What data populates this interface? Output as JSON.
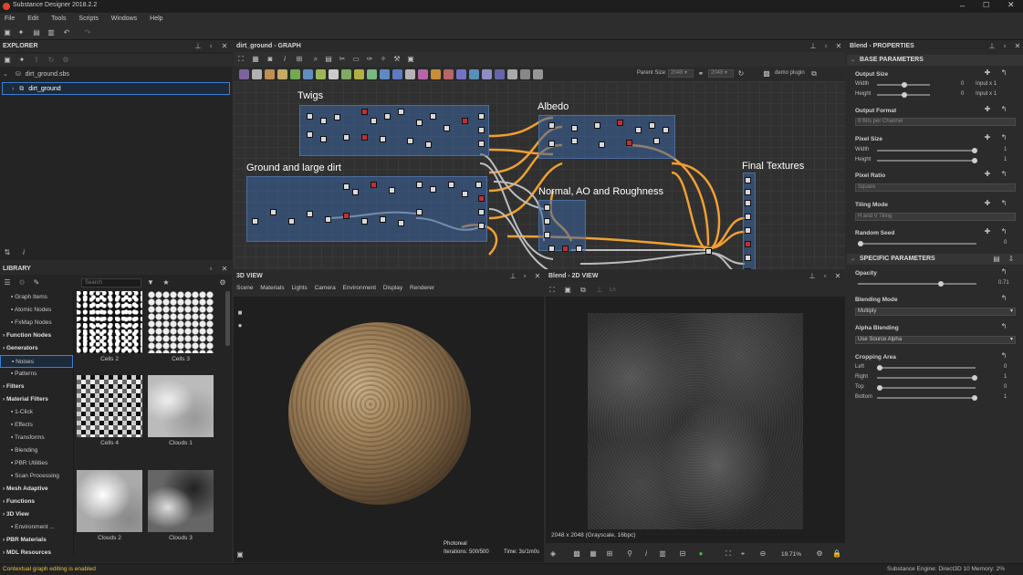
{
  "app": {
    "title": "Substance Designer 2018.2.2"
  },
  "menu": [
    "File",
    "Edit",
    "Tools",
    "Scripts",
    "Windows",
    "Help"
  ],
  "explorer": {
    "title": "EXPLORER",
    "file": "dirt_ground.sbs",
    "graph": "dirt_ground"
  },
  "library": {
    "title": "LIBRARY",
    "search_placeholder": "Search",
    "categories": [
      {
        "label": "Graph Items",
        "bold": false
      },
      {
        "label": "Atomic Nodes",
        "bold": false
      },
      {
        "label": "FxMap Nodes",
        "bold": false
      },
      {
        "label": "Function Nodes",
        "bold": true
      },
      {
        "label": "Generators",
        "bold": true
      },
      {
        "label": "Noises",
        "bold": false,
        "selected": true
      },
      {
        "label": "Patterns",
        "bold": false
      },
      {
        "label": "Filters",
        "bold": true
      },
      {
        "label": "Material Filters",
        "bold": true
      },
      {
        "label": "1-Click",
        "bold": false
      },
      {
        "label": "Effects",
        "bold": false
      },
      {
        "label": "Transforms",
        "bold": false
      },
      {
        "label": "Blending",
        "bold": false
      },
      {
        "label": "PBR Utilities",
        "bold": false
      },
      {
        "label": "Scan Processing",
        "bold": false
      },
      {
        "label": "Mesh Adaptive",
        "bold": true
      },
      {
        "label": "Functions",
        "bold": true
      },
      {
        "label": "3D View",
        "bold": true
      },
      {
        "label": "Environment ...",
        "bold": false
      },
      {
        "label": "PBR Materials",
        "bold": true
      },
      {
        "label": "MDL Resources",
        "bold": true
      }
    ],
    "thumbs": [
      "Cells 2",
      "Cells 3",
      "Cells 4",
      "Clouds 1",
      "Clouds 2",
      "Clouds 3"
    ]
  },
  "graph": {
    "title": "dirt_ground - GRAPH",
    "parent_size_label": "Parent Size:",
    "parent_size": "2048",
    "size2": "2048",
    "plugin": "demo plugin",
    "frames": [
      "Twigs",
      "Albedo",
      "Ground and large dirt",
      "Normal, AO and Roughness",
      "Final Textures"
    ]
  },
  "view3d": {
    "title": "3D VIEW",
    "menu": [
      "Scene",
      "Materials",
      "Lights",
      "Camera",
      "Environment",
      "Display",
      "Renderer"
    ],
    "renderer": "Photoreal",
    "iterations": "Iterations: 500/500",
    "time": "Time: 3s/1m0s"
  },
  "view2d": {
    "title": "Blend - 2D VIEW",
    "dropdown": "Lh",
    "info": "2048 x 2048 (Grayscale, 16bpc)",
    "zoom": "19.71%"
  },
  "properties": {
    "title": "Blend - PROPERTIES",
    "base_title": "BASE PARAMETERS",
    "output_size": "Output Size",
    "width": "Width",
    "height": "Height",
    "out_w_val": "0",
    "out_h_val": "0",
    "out_w_mode": "Input x 1",
    "out_h_mode": "Input x 1",
    "output_format": "Output Format",
    "output_format_val": "8 Bits per Channel",
    "pixel_size": "Pixel Size",
    "px_w_val": "1",
    "px_h_val": "1",
    "pixel_ratio": "Pixel Ratio",
    "pixel_ratio_val": "Square",
    "tiling_mode": "Tiling Mode",
    "tiling_mode_val": "H and V Tiling",
    "random_seed": "Random Seed",
    "random_seed_val": "0",
    "specific_title": "SPECIFIC PARAMETERS",
    "opacity": "Opacity",
    "opacity_val": "0.71",
    "opacity_frac": 0.71,
    "blending_mode": "Blending Mode",
    "blending_mode_val": "Multiply",
    "alpha_blending": "Alpha Blending",
    "alpha_blending_val": "Use Source Alpha",
    "cropping_area": "Cropping Area",
    "left": "Left",
    "right": "Right",
    "top": "Top",
    "bottom": "Bottom",
    "crop_left": "0",
    "crop_right": "1",
    "crop_top": "0",
    "crop_bottom": "1"
  },
  "status": {
    "left": "Contextual graph editing is enabled",
    "right": "Substance Engine: Direct3D 10  Memory: 2%"
  },
  "colors": {
    "accent": "#f5a623",
    "frame": "#3c64a0",
    "node_edge": "#f0a030"
  }
}
